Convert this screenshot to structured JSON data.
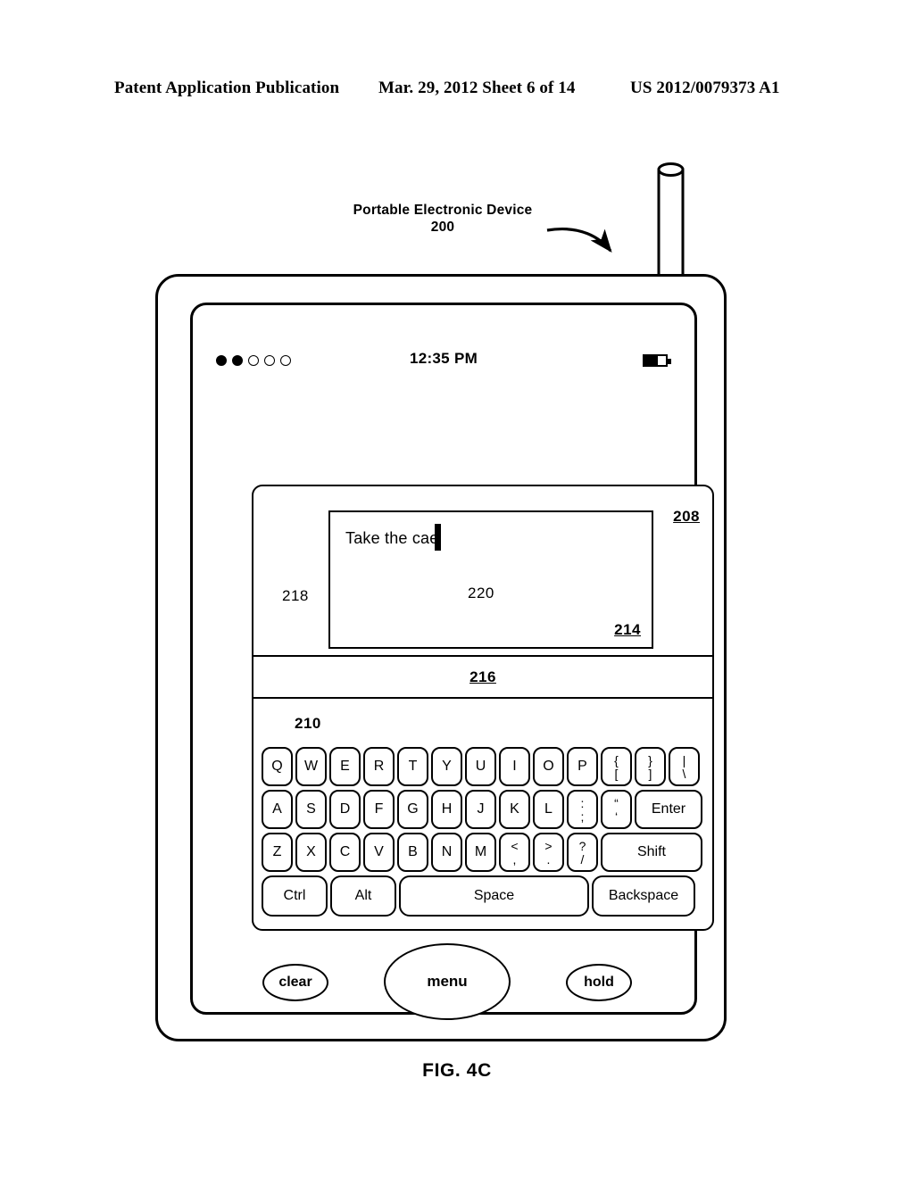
{
  "header": {
    "left": "Patent Application Publication",
    "middle": "Mar. 29, 2012  Sheet 6 of 14",
    "right": "US 2012/0079373 A1"
  },
  "callout": {
    "title": "Portable Electronic Device",
    "number": "200"
  },
  "device": {
    "status_bar": {
      "signal_dots_total": 5,
      "signal_dots_filled": 2,
      "time": "12:35 PM",
      "battery_level_percent": 62
    },
    "panel": {
      "ref": "208",
      "display": {
        "textbox_ref": "214",
        "entered_text": "Take the cae",
        "cursor_ref": "220",
        "text_ref": "218"
      },
      "candidate_bar_ref": "216",
      "keyboard": {
        "ref": "210",
        "rows": [
          [
            {
              "type": "single",
              "label": "Q"
            },
            {
              "type": "single",
              "label": "W"
            },
            {
              "type": "single",
              "label": "E"
            },
            {
              "type": "single",
              "label": "R"
            },
            {
              "type": "single",
              "label": "T"
            },
            {
              "type": "single",
              "label": "Y"
            },
            {
              "type": "single",
              "label": "U"
            },
            {
              "type": "single",
              "label": "I"
            },
            {
              "type": "single",
              "label": "O"
            },
            {
              "type": "single",
              "label": "P"
            },
            {
              "type": "dual",
              "top": "{",
              "bottom": "["
            },
            {
              "type": "dual",
              "top": "}",
              "bottom": "]"
            },
            {
              "type": "dual",
              "top": "|",
              "bottom": "\\"
            }
          ],
          [
            {
              "type": "single",
              "label": "A"
            },
            {
              "type": "single",
              "label": "S"
            },
            {
              "type": "single",
              "label": "D"
            },
            {
              "type": "single",
              "label": "F"
            },
            {
              "type": "single",
              "label": "G"
            },
            {
              "type": "single",
              "label": "H"
            },
            {
              "type": "single",
              "label": "J"
            },
            {
              "type": "single",
              "label": "K"
            },
            {
              "type": "single",
              "label": "L"
            },
            {
              "type": "dual",
              "top": ":",
              "bottom": ";"
            },
            {
              "type": "dual",
              "top": "“",
              "bottom": "‘"
            },
            {
              "type": "wide",
              "label": "Enter",
              "style": "wide-enter"
            }
          ],
          [
            {
              "type": "single",
              "label": "Z"
            },
            {
              "type": "single",
              "label": "X"
            },
            {
              "type": "single",
              "label": "C"
            },
            {
              "type": "single",
              "label": "V"
            },
            {
              "type": "single",
              "label": "B"
            },
            {
              "type": "single",
              "label": "N"
            },
            {
              "type": "single",
              "label": "M"
            },
            {
              "type": "dual",
              "top": "<",
              "bottom": ","
            },
            {
              "type": "dual",
              "top": ">",
              "bottom": "."
            },
            {
              "type": "dual",
              "top": "?",
              "bottom": "/"
            },
            {
              "type": "wide",
              "label": "Shift",
              "style": "wide-shift"
            }
          ],
          [
            {
              "type": "wide",
              "label": "Ctrl",
              "style": "mod-ctrl"
            },
            {
              "type": "wide",
              "label": "Alt",
              "style": "mod-alt"
            },
            {
              "type": "wide",
              "label": "Space",
              "style": "space"
            },
            {
              "type": "wide",
              "label": "Backspace",
              "style": "backspace"
            }
          ]
        ]
      }
    },
    "hardware_buttons": {
      "clear": "clear",
      "menu": "menu",
      "hold": "hold"
    }
  },
  "figure_caption": "FIG. 4C",
  "colors": {
    "ink": "#000000",
    "paper": "#ffffff"
  }
}
